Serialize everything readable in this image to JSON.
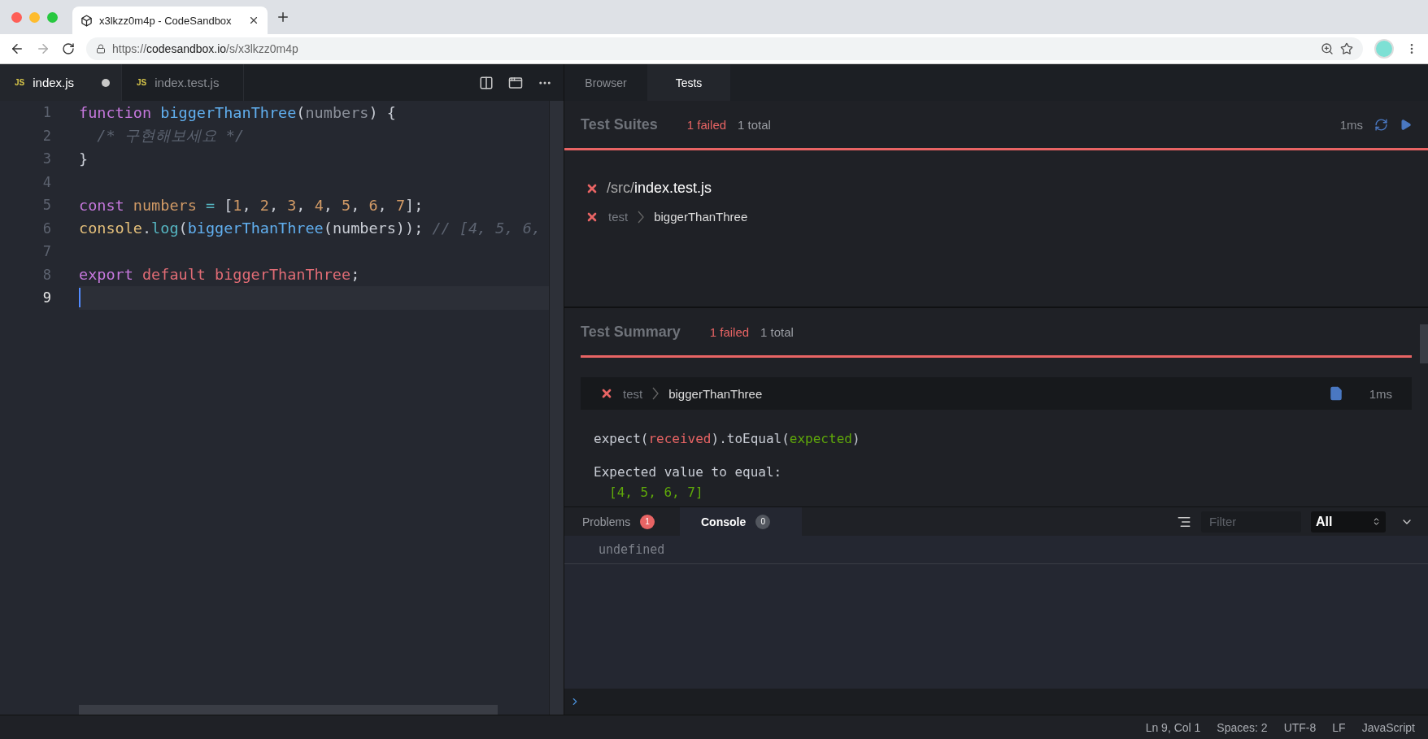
{
  "browser": {
    "tab_title": "x3lkzz0m4p - CodeSandbox",
    "url_scheme": "https://",
    "url_host": "codesandbox.io",
    "url_path": "/s/x3lkzz0m4p"
  },
  "editor": {
    "tabs": [
      {
        "badge": "JS",
        "label": "index.js",
        "selected": true,
        "modified": true
      },
      {
        "badge": "JS",
        "label": "index.test.js",
        "selected": false,
        "modified": false
      }
    ],
    "lines": [
      {
        "number": "1",
        "active": false,
        "tokens": [
          {
            "kind": "keyword",
            "text": "function "
          },
          {
            "kind": "function",
            "text": "biggerThanThree"
          },
          {
            "kind": "plain",
            "text": "("
          },
          {
            "kind": "param",
            "text": "numbers"
          },
          {
            "kind": "plain",
            "text": ") {"
          }
        ]
      },
      {
        "number": "2",
        "active": false,
        "tokens": [
          {
            "kind": "comment",
            "text": "  /* 구현해보세요 */"
          }
        ]
      },
      {
        "number": "3",
        "active": false,
        "tokens": [
          {
            "kind": "plain",
            "text": "}"
          }
        ]
      },
      {
        "number": "4",
        "active": false
      },
      {
        "number": "5",
        "active": false,
        "tokens": [
          {
            "kind": "keyword",
            "text": "const "
          },
          {
            "kind": "variable",
            "text": "numbers "
          },
          {
            "kind": "operator",
            "text": "="
          },
          {
            "kind": "plain",
            "text": " ["
          },
          {
            "kind": "variable",
            "text": "1"
          },
          {
            "kind": "plain",
            "text": ", "
          },
          {
            "kind": "variable",
            "text": "2"
          },
          {
            "kind": "plain",
            "text": ", "
          },
          {
            "kind": "variable",
            "text": "3"
          },
          {
            "kind": "plain",
            "text": ", "
          },
          {
            "kind": "variable",
            "text": "4"
          },
          {
            "kind": "plain",
            "text": ", "
          },
          {
            "kind": "variable",
            "text": "5"
          },
          {
            "kind": "plain",
            "text": ", "
          },
          {
            "kind": "variable",
            "text": "6"
          },
          {
            "kind": "plain",
            "text": ", "
          },
          {
            "kind": "variable",
            "text": "7"
          },
          {
            "kind": "plain",
            "text": "];"
          }
        ]
      },
      {
        "number": "6",
        "active": false,
        "tokens": [
          {
            "kind": "object",
            "text": "console"
          },
          {
            "kind": "plain",
            "text": "."
          },
          {
            "kind": "method",
            "text": "log"
          },
          {
            "kind": "plain",
            "text": "("
          },
          {
            "kind": "function",
            "text": "biggerThanThree"
          },
          {
            "kind": "plain",
            "text": "(numbers)); "
          },
          {
            "kind": "comment",
            "text": "// [4, 5, 6,"
          }
        ]
      },
      {
        "number": "7",
        "active": false
      },
      {
        "number": "8",
        "active": false,
        "tokens": [
          {
            "kind": "keyword",
            "text": "export "
          },
          {
            "kind": "export",
            "text": "default biggerThanThree"
          },
          {
            "kind": "plain",
            "text": ";"
          }
        ]
      },
      {
        "number": "9",
        "active": true
      }
    ]
  },
  "preview": {
    "tabs": [
      {
        "label": "Browser",
        "selected": false
      },
      {
        "label": "Tests",
        "selected": true
      }
    ],
    "suites": {
      "title": "Test Suites",
      "failed": "1 failed",
      "total": "1 total",
      "time": "1ms",
      "files": [
        {
          "failed": true,
          "dir": "/src/",
          "name": "index.test.js",
          "tests": [
            {
              "failed": true,
              "scope": "test",
              "name": "biggerThanThree"
            }
          ]
        }
      ]
    },
    "summary": {
      "title": "Test Summary",
      "failed": "1 failed",
      "total": "1 total",
      "results": [
        {
          "failed": true,
          "scope": "test",
          "name": "biggerThanThree",
          "time": "1ms",
          "message": [
            {
              "kind": "code",
              "tokens": [
                {
                  "kind": "plain",
                  "text": "expect("
                },
                {
                  "kind": "received",
                  "text": "received"
                },
                {
                  "kind": "plain",
                  "text": ").toEqual("
                },
                {
                  "kind": "expected",
                  "text": "expected"
                },
                {
                  "kind": "plain",
                  "text": ")"
                }
              ]
            },
            {
              "kind": "heading",
              "tokens": [
                {
                  "kind": "plain",
                  "text": "Expected value to equal:"
                }
              ]
            },
            {
              "kind": "value",
              "tokens": [
                {
                  "kind": "expected",
                  "text": "[4, 5, 6, 7]"
                }
              ]
            }
          ]
        }
      ]
    }
  },
  "console": {
    "tabs": [
      {
        "label": "Problems",
        "count": "1",
        "color": "#e86464",
        "selected": false
      },
      {
        "label": "Console",
        "count": "0",
        "color": "#52565e",
        "selected": true
      }
    ],
    "filter": {
      "placeholder": "Filter"
    },
    "level": "All",
    "output": [
      "undefined"
    ]
  },
  "status_bar": [
    "Ln 9, Col 1",
    "Spaces: 2",
    "UTF-8",
    "LF",
    "JavaScript"
  ]
}
